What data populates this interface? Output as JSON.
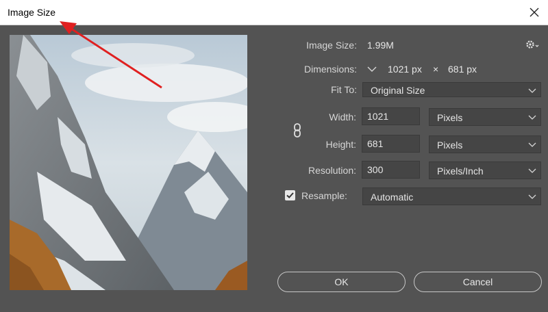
{
  "window": {
    "title": "Image Size"
  },
  "info": {
    "image_size_label": "Image Size:",
    "image_size_value": "1.99M",
    "dimensions_label": "Dimensions:",
    "dimensions_w": "1021 px",
    "dimensions_sep": "×",
    "dimensions_h": "681 px",
    "fit_to_label": "Fit To:",
    "fit_to_value": "Original Size"
  },
  "fields": {
    "width_label": "Width:",
    "width_value": "1021",
    "width_unit": "Pixels",
    "height_label": "Height:",
    "height_value": "681",
    "height_unit": "Pixels",
    "resolution_label": "Resolution:",
    "resolution_value": "300",
    "resolution_unit": "Pixels/Inch"
  },
  "resample": {
    "label": "Resample:",
    "checked": true,
    "value": "Automatic"
  },
  "buttons": {
    "ok": "OK",
    "cancel": "Cancel"
  },
  "icons": {
    "close": "close-icon",
    "gear": "gear-icon",
    "link": "link-icon",
    "chevron": "chevron-down-icon",
    "check": "checkmark-icon"
  },
  "colors": {
    "dialog_bg": "#535353",
    "field_bg": "#454545",
    "annotation_arrow": "#e02020"
  }
}
